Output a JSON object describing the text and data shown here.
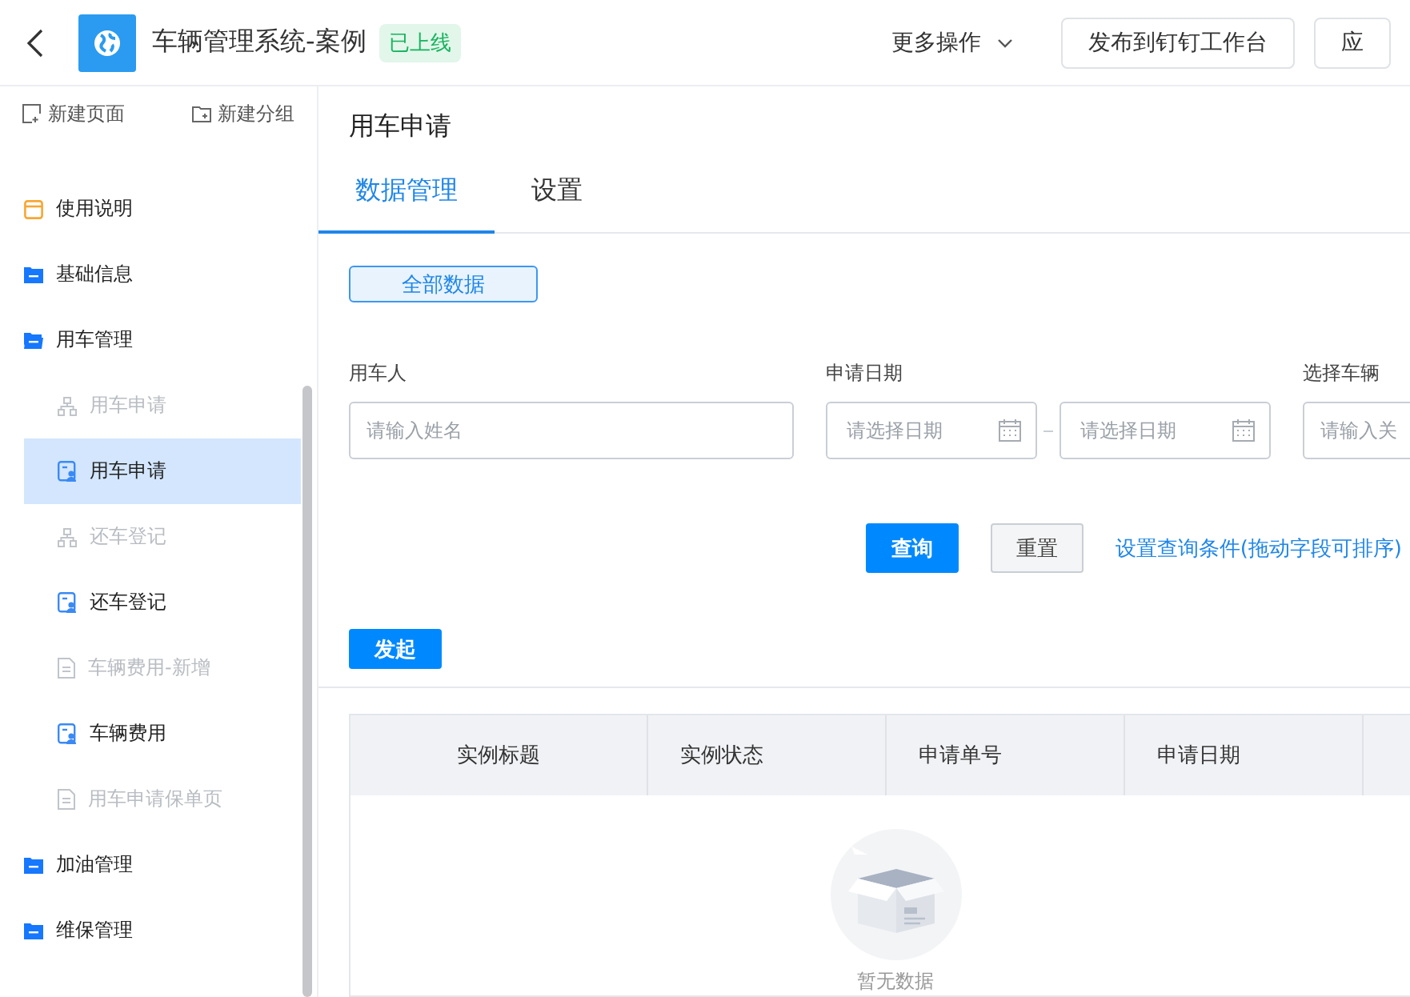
{
  "header": {
    "title": "车辆管理系统-案例",
    "status_badge": "已上线",
    "more_actions": "更多操作",
    "buttons": [
      "发布到钉钉工作台",
      "应"
    ]
  },
  "sidebar": {
    "actions": [
      {
        "label": "新建页面",
        "kind": "page"
      },
      {
        "label": "新建分组",
        "kind": "folder"
      }
    ],
    "items": [
      {
        "label": "使用说明",
        "kind": "home",
        "selected": false,
        "hidden": false
      },
      {
        "label": "基础信息",
        "kind": "folder",
        "expanded": false,
        "selected": false,
        "hidden": false
      },
      {
        "label": "用车管理",
        "kind": "folder",
        "expanded": true,
        "selected": false,
        "hidden": false,
        "children": [
          {
            "label": "用车申请",
            "kind": "flow",
            "selected": false,
            "hidden": true
          },
          {
            "label": "用车申请",
            "kind": "form",
            "selected": true,
            "hidden": false
          },
          {
            "label": "还车登记",
            "kind": "flow",
            "selected": false,
            "hidden": true
          },
          {
            "label": "还车登记",
            "kind": "form",
            "selected": false,
            "hidden": false
          },
          {
            "label": "车辆费用-新增",
            "kind": "doc",
            "selected": false,
            "hidden": true
          },
          {
            "label": "车辆费用",
            "kind": "form",
            "selected": false,
            "hidden": false
          },
          {
            "label": "用车申请保单页",
            "kind": "doc",
            "selected": false,
            "hidden": true
          }
        ]
      },
      {
        "label": "加油管理",
        "kind": "folder",
        "expanded": false,
        "selected": false,
        "hidden": false
      },
      {
        "label": "维保管理",
        "kind": "folder",
        "expanded": false,
        "selected": false,
        "hidden": false
      }
    ]
  },
  "main": {
    "page_title": "用车申请",
    "tabs": [
      {
        "label": "数据管理",
        "selected": true
      },
      {
        "label": "设置",
        "selected": false
      }
    ],
    "filter_button": {
      "label": "全部数据",
      "selected": true
    },
    "fields": [
      {
        "label": "用车人",
        "kind": "text",
        "placeholder": "请输入姓名"
      },
      {
        "label": "申请日期",
        "kind": "date_range",
        "placeholders": [
          "请选择日期",
          "请选择日期"
        ]
      },
      {
        "label": "选择车辆",
        "kind": "text",
        "placeholder": "请输入关"
      }
    ],
    "query_button": "查询",
    "reset_button": "重置",
    "settings_link": "设置查询条件(拖动字段可排序)",
    "create_button": "发起",
    "table": {
      "columns": [
        "实例标题",
        "实例状态",
        "申请单号",
        "申请日期"
      ],
      "empty_text": "暂无数据"
    }
  }
}
